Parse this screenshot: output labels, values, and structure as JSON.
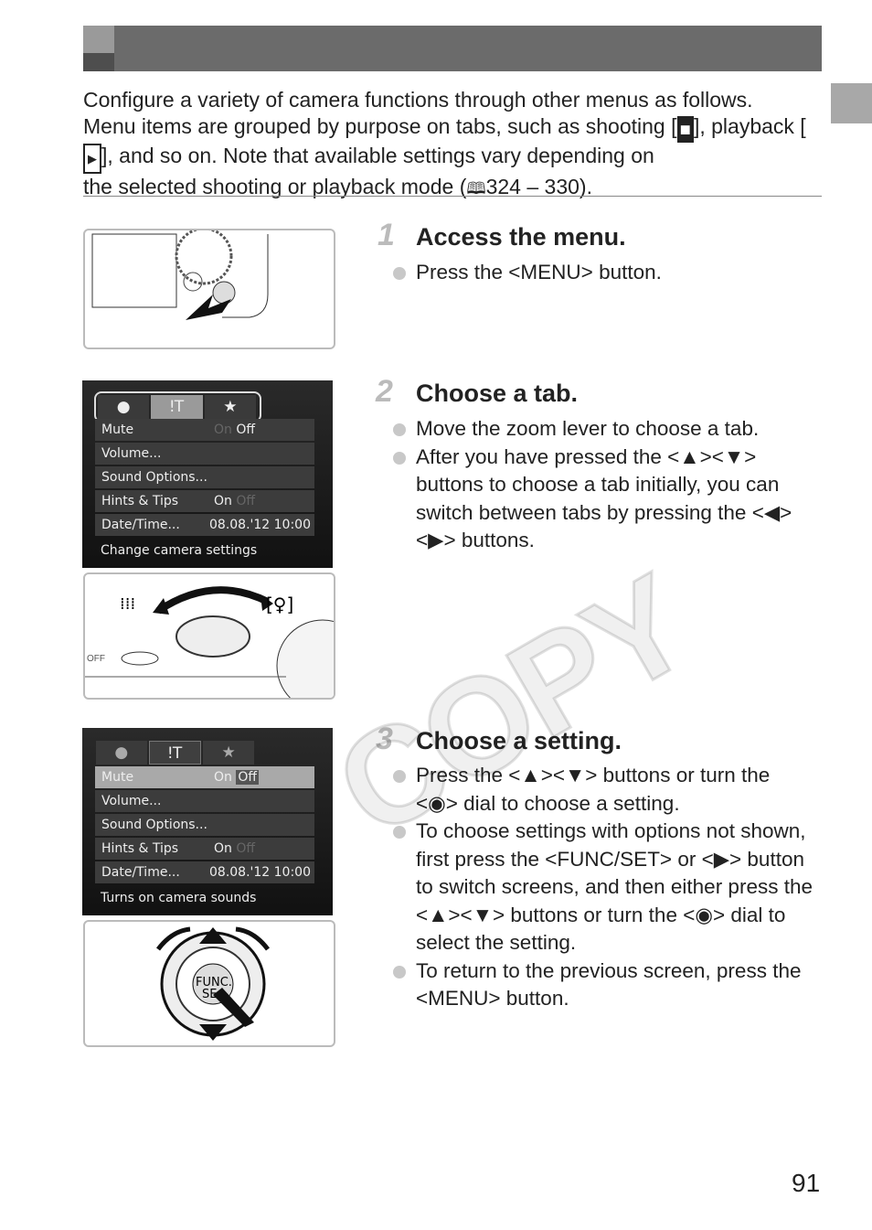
{
  "intro": {
    "lines": [
      "Configure a variety of camera functions through other menus as follows.",
      "Menu items are grouped by purpose on tabs, such as shooting [",
      "], playback [",
      "], and so on. Note that available settings vary depending on",
      "the selected shooting or playback mode (",
      "324 – 330)."
    ]
  },
  "watermark": "COPY",
  "steps": [
    {
      "num": "1",
      "title": "Access the menu.",
      "bullets": [
        "Press the <MENU> button."
      ]
    },
    {
      "num": "2",
      "title": "Choose a tab.",
      "bullets": [
        "Move the zoom lever to choose a tab.",
        "After you have pressed the <▲><▼> buttons to choose a tab initially, you can switch between tabs by pressing the <◀><▶> buttons."
      ]
    },
    {
      "num": "3",
      "title": "Choose a setting.",
      "bullets": [
        "Press the <▲><▼> buttons or turn the <◉> dial to choose a setting.",
        "To choose settings with options not shown, first press the <FUNC/SET> or <▶> button to switch screens, and then either press the <▲><▼> buttons or turn the <◉> dial to select the setting.",
        "To return to the previous screen, press the <MENU> button."
      ]
    }
  ],
  "screen1": {
    "tabs": [
      "camera-icon",
      "wrench-icon",
      "star-icon"
    ],
    "rows": [
      {
        "label": "Mute",
        "a": "On",
        "b": "Off"
      },
      {
        "label": "Volume...",
        "a": "",
        "b": ""
      },
      {
        "label": "Sound Options...",
        "a": "",
        "b": ""
      },
      {
        "label": "Hints & Tips",
        "a": "On",
        "b": "Off"
      },
      {
        "label": "Date/Time...",
        "a": "08.08.'12 10:00",
        "b": ""
      }
    ],
    "footer": "Change camera settings"
  },
  "screen2": {
    "footer": "Turns on camera sounds"
  },
  "page_number": "91"
}
